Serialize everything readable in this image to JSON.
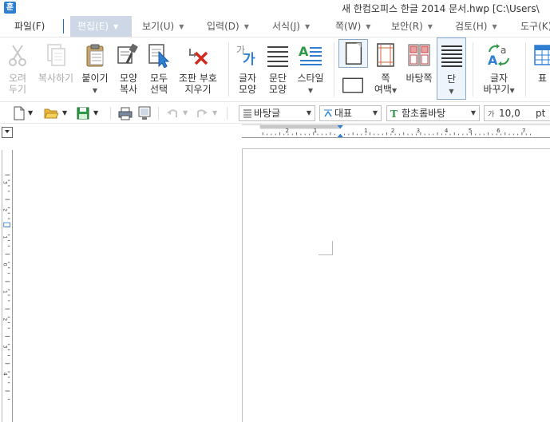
{
  "title_bar": {
    "app_icon": "hancom-hangul-icon",
    "title": "새 한컴오피스 한글 2014 문서.hwp [C:\\Users\\"
  },
  "menu": {
    "items": [
      {
        "id": "file",
        "label": "파일(F)"
      },
      {
        "id": "edit",
        "label": "편집(E)",
        "active": true
      },
      {
        "id": "view",
        "label": "보기(U)"
      },
      {
        "id": "input",
        "label": "입력(D)"
      },
      {
        "id": "format",
        "label": "서식(J)"
      },
      {
        "id": "page",
        "label": "쪽(W)"
      },
      {
        "id": "security",
        "label": "보안(R)"
      },
      {
        "id": "review",
        "label": "검토(H)"
      },
      {
        "id": "tools",
        "label": "도구(K)"
      }
    ]
  },
  "ribbon": {
    "cut": {
      "line1": "오려",
      "line2": "두기",
      "icon": "scissors-icon",
      "enabled": false
    },
    "copy": {
      "label": "복사하기",
      "icon": "copy-icon",
      "enabled": false
    },
    "paste": {
      "label": "붙이기",
      "icon": "clipboard-icon"
    },
    "format_copy": {
      "line1": "모양",
      "line2": "복사",
      "icon": "paintbrush-icon"
    },
    "select_all": {
      "line1": "모두",
      "line2": "선택",
      "icon": "select-all-icon"
    },
    "clear_marks": {
      "line1": "조판 부호",
      "line2": "지우기",
      "icon": "clear-marks-icon"
    },
    "char_shape": {
      "line1": "글자",
      "line2": "모양",
      "icon": "char-shape-icon",
      "glyph": "가"
    },
    "para_shape": {
      "line1": "문단",
      "line2": "모양",
      "icon": "paragraph-icon"
    },
    "style": {
      "label": "스타일",
      "icon": "style-icon"
    },
    "page_margin": {
      "line1": "쪽",
      "line2": "여백",
      "icon": "page-margin-icon"
    },
    "background_page": {
      "label": "바탕쪽",
      "icon": "background-page-icon"
    },
    "columns": {
      "label": "단",
      "icon": "columns-icon"
    },
    "char_replace": {
      "line1": "글자",
      "line2": "바꾸기",
      "icon": "char-replace-icon"
    },
    "table": {
      "label": "표",
      "icon": "table-icon"
    }
  },
  "quickbar": {
    "style_select": "바탕글",
    "lang_select": "대표",
    "font_select": "함초롬바탕",
    "font_size": "10,0",
    "font_unit": "pt"
  },
  "colors": {
    "accent": "#2e7fd2",
    "menu_active_bg": "#cdd7e5",
    "red_x": "#d32a1f",
    "green": "#2e9a48"
  }
}
